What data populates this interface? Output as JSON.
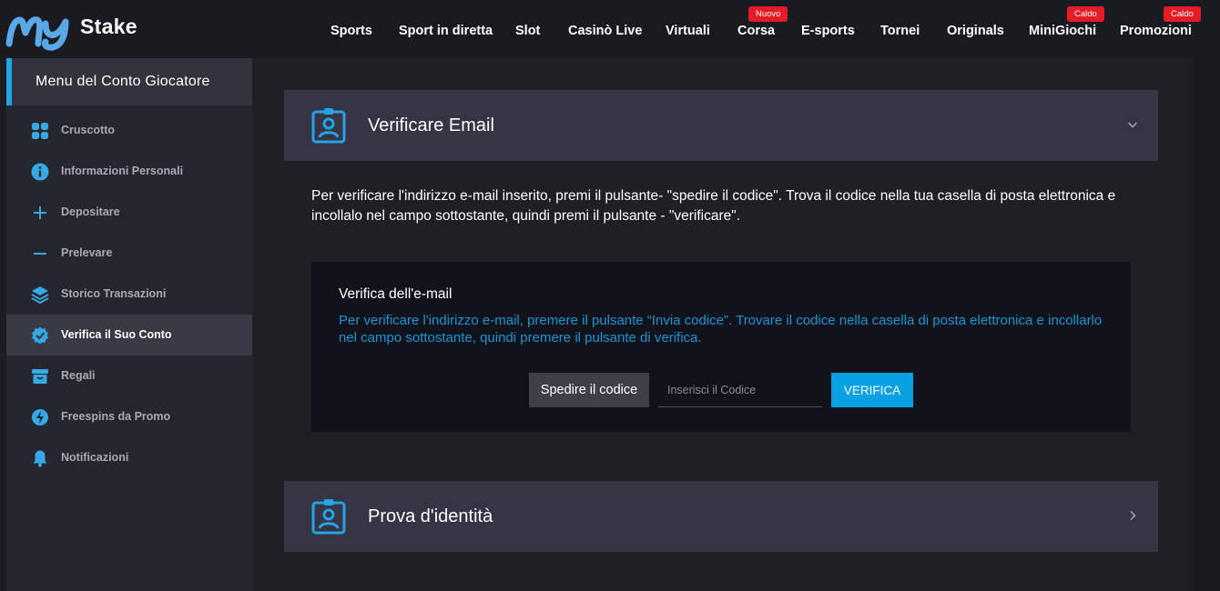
{
  "header": {
    "logo_text": "Stake",
    "logo_script": "My",
    "nav": [
      {
        "label": "Sports",
        "badge": ""
      },
      {
        "label": "Sport in diretta",
        "badge": ""
      },
      {
        "label": "Slot",
        "badge": ""
      },
      {
        "label": "Casinò Live",
        "badge": ""
      },
      {
        "label": "Virtuali",
        "badge": ""
      },
      {
        "label": "Corsa",
        "badge": "Nuovo"
      },
      {
        "label": "E-sports",
        "badge": ""
      },
      {
        "label": "Tornei",
        "badge": ""
      },
      {
        "label": "Originals",
        "badge": ""
      },
      {
        "label": "MiniGiochi",
        "badge": "Caldo"
      },
      {
        "label": "Promozioni",
        "badge": "Caldo"
      }
    ]
  },
  "sidebar": {
    "title": "Menu del Conto Giocatore",
    "items": [
      {
        "label": "Cruscotto",
        "icon": "dashboard-icon"
      },
      {
        "label": "Informazioni Personali",
        "icon": "info-icon"
      },
      {
        "label": "Depositare",
        "icon": "plus-icon"
      },
      {
        "label": "Prelevare",
        "icon": "minus-icon"
      },
      {
        "label": "Storico Transazioni",
        "icon": "layers-icon"
      },
      {
        "label": "Verifica il Suo Conto",
        "icon": "verified-badge-icon",
        "active": true
      },
      {
        "label": "Regali",
        "icon": "gift-icon"
      },
      {
        "label": "Freespins da Promo",
        "icon": "freespin-icon"
      },
      {
        "label": "Notificazioni",
        "icon": "bell-icon"
      }
    ]
  },
  "main": {
    "email_panel": {
      "title": "Verificare Email",
      "intro": "Per verificare l'indirizzo e-mail inserito, premi il pulsante- \"spedire il codice\". Trova il codice nella tua casella di posta elettronica e incollalo nel campo sottostante, quindi premi il pulsante - \"verificare\".",
      "box_title": "Verifica dell'e-mail",
      "box_desc": "Per verificare l'indirizzo e-mail, premere il pulsante “Invia codice”. Trovare il codice nella casella di posta elettronica e incollarlo nel campo sottostante, quindi premere il pulsante di verifica.",
      "send_label": "Spedire il codice",
      "code_placeholder": "Inserisci il Codice",
      "verify_label": "VERIFICA"
    },
    "identity_panel": {
      "title": "Prova d'identità"
    }
  },
  "colors": {
    "accent": "#0aa1e3",
    "badge": "#e51b26",
    "panel": "#363445",
    "link_text": "#1e94d6"
  }
}
